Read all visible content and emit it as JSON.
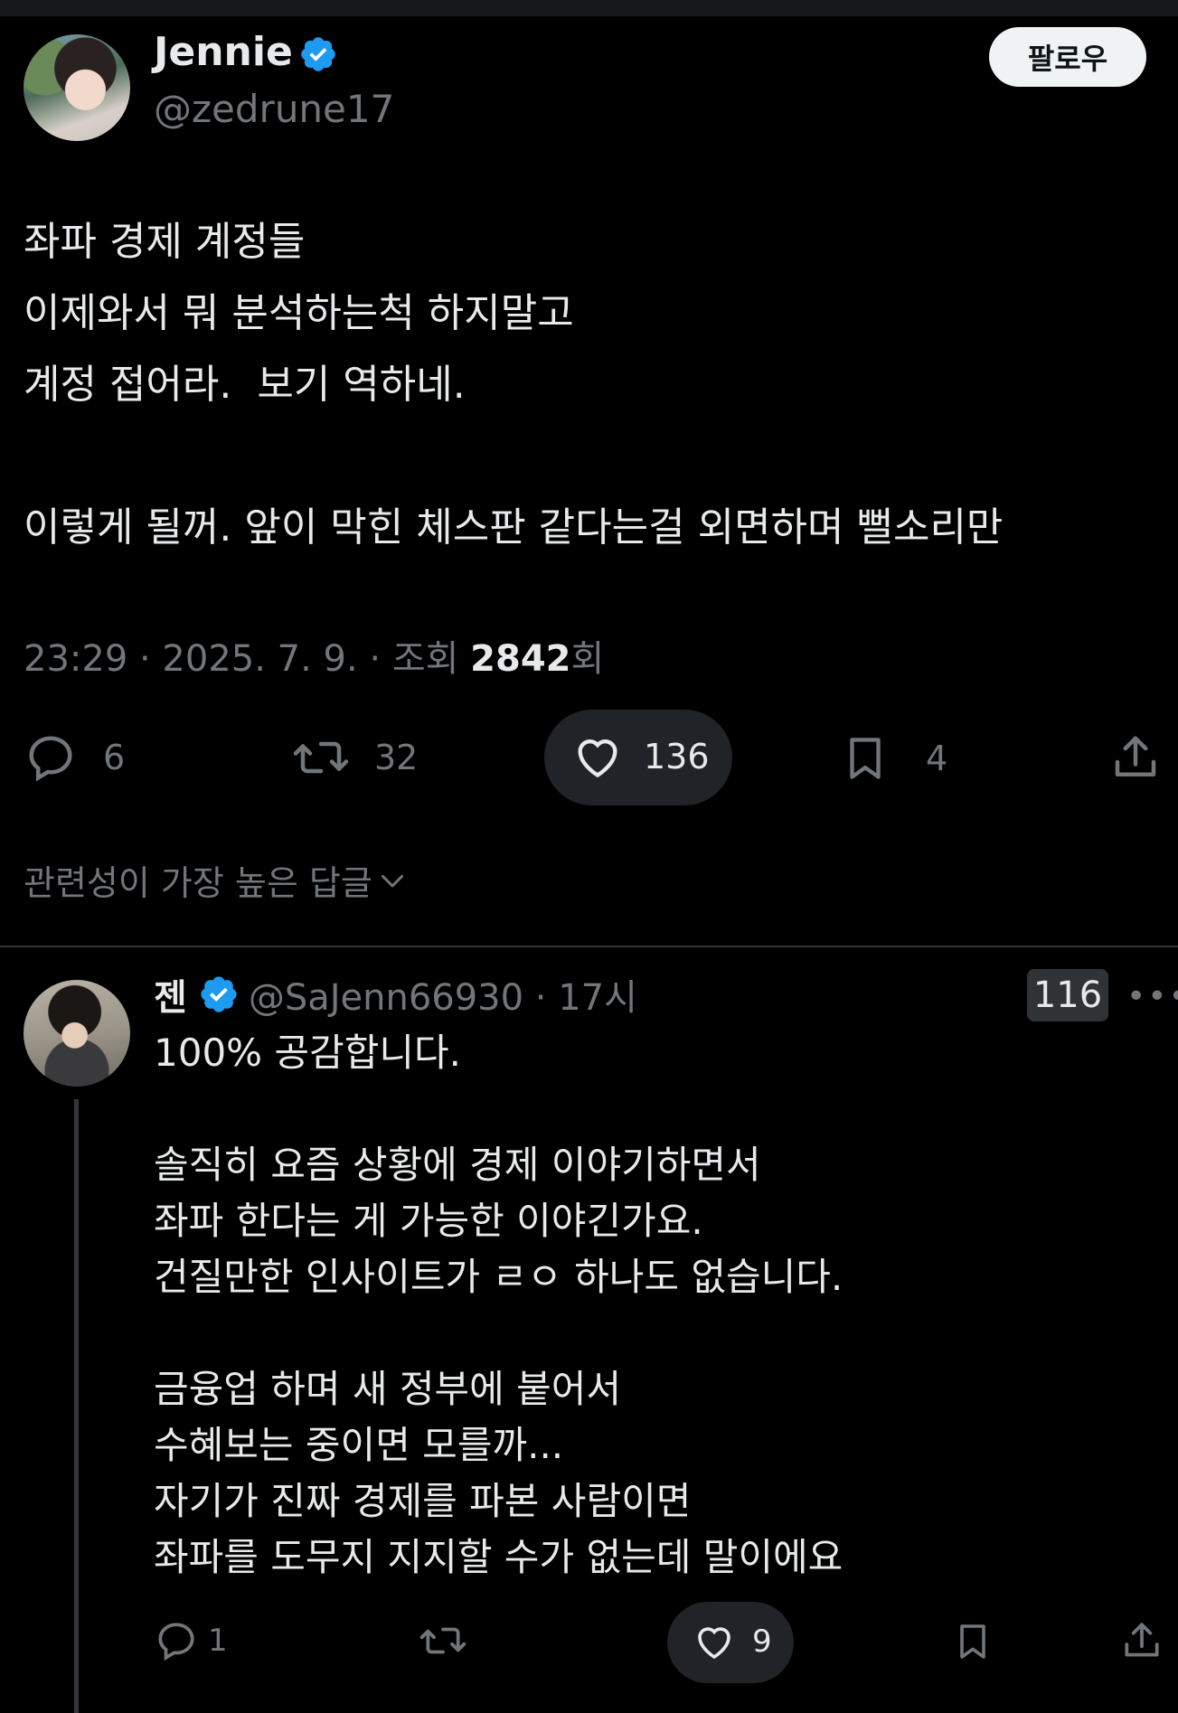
{
  "main_tweet": {
    "author_name": "Jennie",
    "author_handle": "@zedrune17",
    "follow_label": "팔로우",
    "text": "좌파 경제 계정들\n이제와서 뭐 분석하는척 하지말고\n계정 접어라.  보기 역하네.\n\n이렇게 될꺼. 앞이 막힌 체스판 같다는걸 외면하며 뻘소리만",
    "meta_prefix": "23:29 · 2025. 7. 9. · 조회 ",
    "views": "2842",
    "views_suffix": "회",
    "actions": {
      "replies": "6",
      "retweets": "32",
      "likes": "136",
      "bookmarks": "4"
    },
    "sort_label": "관련성이 가장 높은 답글"
  },
  "reply": {
    "author_name": "젠",
    "author_handle": "@SaJenn66930 · 17시",
    "badge": "116",
    "more": "•••",
    "text": "100% 공감합니다.\n\n솔직히 요즘 상황에 경제 이야기하면서\n좌파 한다는 게 가능한 이야긴가요.\n건질만한 인사이트가 ㄹㅇ 하나도 없습니다.\n\n금융업 하며 새 정부에 붙어서\n수혜보는 중이면 모를까...\n자기가 진짜 경제를 파본 사람이면\n좌파를 도무지 지지할 수가 없는데 말이에요",
    "actions": {
      "replies": "1",
      "likes": "9"
    }
  },
  "colors": {
    "background": "#000000",
    "text": "#e7e9ea",
    "muted": "#71767b",
    "verified": "#1d9bf0"
  }
}
